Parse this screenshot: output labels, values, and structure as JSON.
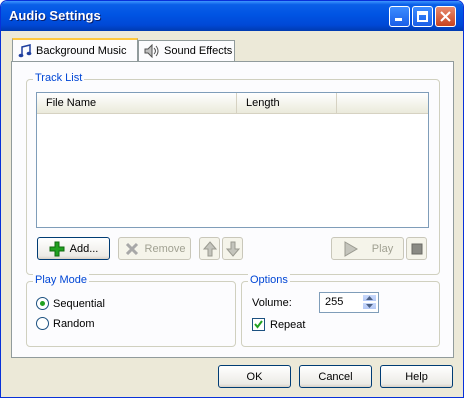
{
  "window": {
    "title": "Audio Settings"
  },
  "tabs": [
    {
      "label": "Background Music",
      "icon": "music-note-icon",
      "active": true
    },
    {
      "label": "Sound Effects",
      "icon": "speaker-icon",
      "active": false
    }
  ],
  "track_list": {
    "group_label": "Track List",
    "columns": [
      "File Name",
      "Length"
    ],
    "rows": []
  },
  "toolbar": {
    "add_label": "Add...",
    "remove_label": "Remove",
    "play_label": "Play"
  },
  "play_mode": {
    "group_label": "Play Mode",
    "options": [
      {
        "label": "Sequential",
        "selected": true
      },
      {
        "label": "Random",
        "selected": false
      }
    ]
  },
  "options": {
    "group_label": "Options",
    "volume_label": "Volume:",
    "volume_value": "255",
    "repeat_label": "Repeat",
    "repeat_checked": true
  },
  "footer": {
    "ok_label": "OK",
    "cancel_label": "Cancel",
    "help_label": "Help"
  },
  "colors": {
    "titlebar": "#0054e3",
    "dialog_bg": "#ece9d8",
    "group_label": "#0046d5",
    "add_icon": "#21a121"
  }
}
